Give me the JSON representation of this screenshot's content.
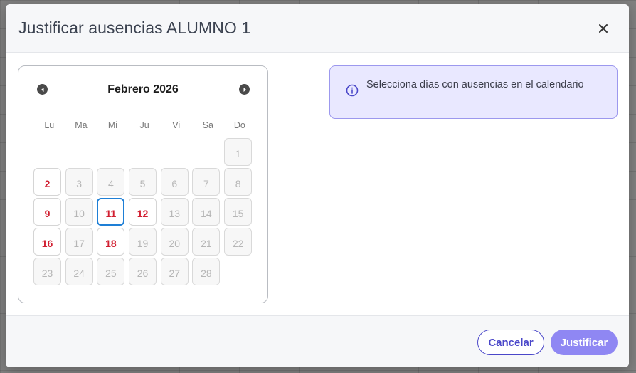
{
  "dialog": {
    "title": "Justificar ausencias ALUMNO 1",
    "close_icon": "close-icon"
  },
  "calendar": {
    "month_label": "Febrero 2026",
    "prev_icon": "chevron-left-icon",
    "next_icon": "chevron-right-icon",
    "weekdays": [
      "Lu",
      "Ma",
      "Mi",
      "Ju",
      "Vi",
      "Sa",
      "Do"
    ],
    "leading_blanks": 6,
    "days": [
      {
        "label": "1",
        "state": "disabled"
      },
      {
        "label": "2",
        "state": "active"
      },
      {
        "label": "3",
        "state": "disabled"
      },
      {
        "label": "4",
        "state": "disabled"
      },
      {
        "label": "5",
        "state": "disabled"
      },
      {
        "label": "6",
        "state": "disabled"
      },
      {
        "label": "7",
        "state": "disabled"
      },
      {
        "label": "8",
        "state": "disabled"
      },
      {
        "label": "9",
        "state": "active"
      },
      {
        "label": "10",
        "state": "disabled"
      },
      {
        "label": "11",
        "state": "selected"
      },
      {
        "label": "12",
        "state": "active"
      },
      {
        "label": "13",
        "state": "disabled"
      },
      {
        "label": "14",
        "state": "disabled"
      },
      {
        "label": "15",
        "state": "disabled"
      },
      {
        "label": "16",
        "state": "active"
      },
      {
        "label": "17",
        "state": "disabled"
      },
      {
        "label": "18",
        "state": "active"
      },
      {
        "label": "19",
        "state": "disabled"
      },
      {
        "label": "20",
        "state": "disabled"
      },
      {
        "label": "21",
        "state": "disabled"
      },
      {
        "label": "22",
        "state": "disabled"
      },
      {
        "label": "23",
        "state": "disabled"
      },
      {
        "label": "24",
        "state": "disabled"
      },
      {
        "label": "25",
        "state": "disabled"
      },
      {
        "label": "26",
        "state": "disabled"
      },
      {
        "label": "27",
        "state": "disabled"
      },
      {
        "label": "28",
        "state": "disabled"
      }
    ]
  },
  "info": {
    "icon": "info-icon",
    "text": "Selecciona días con ausencias en el calendario"
  },
  "footer": {
    "cancel_label": "Cancelar",
    "justify_label": "Justificar"
  },
  "colors": {
    "absence_day": "#d11f31",
    "selected_border": "#1e7fd6",
    "primary": "#4a47c9",
    "primary_disabled": "#8f87f3",
    "info_bg": "#e9e8ff"
  }
}
